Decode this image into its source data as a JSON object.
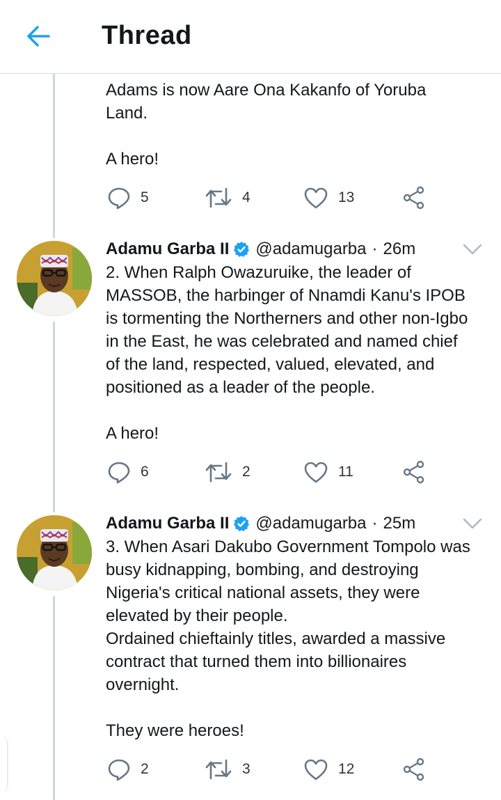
{
  "header": {
    "title": "Thread"
  },
  "colors": {
    "accent": "#1da1f2",
    "icon": "#657786",
    "thread_line": "#cfd6dc"
  },
  "top_tweet": {
    "text": "Adams is now Aare Ona Kakanfo of Yoruba\nLand.\n\nA hero!",
    "replies": "5",
    "retweets": "4",
    "likes": "13"
  },
  "tweets": [
    {
      "author": "Adamu Garba II",
      "handle": "@adamugarba",
      "separator": "·",
      "time": "26m",
      "text": "2. When Ralph Owazuruike, the leader of\nMASSOB, the harbinger of Nnamdi Kanu's IPOB\nis tormenting the Northerners and other non-Igbo\nin the East, he was celebrated and named chief\nof the land, respected, valued, elevated, and\npositioned as a leader of the people.\n\nA hero!",
      "replies": "6",
      "retweets": "2",
      "likes": "11"
    },
    {
      "author": "Adamu Garba II",
      "handle": "@adamugarba",
      "separator": "·",
      "time": "25m",
      "text": "3. When Asari Dakubo Government Tompolo was\nbusy kidnapping, bombing, and destroying\nNigeria's critical national assets, they were\nelevated by their people.\nOrdained chieftainly titles, awarded a massive\ncontract that turned them into billionaires\novernight.\n\nThey were heroes!",
      "replies": "2",
      "retweets": "3",
      "likes": "12"
    }
  ],
  "icons": {
    "back": "arrow-left-icon",
    "reply": "reply-bubble-icon",
    "retweet": "retweet-icon",
    "like": "heart-icon",
    "share": "share-icon",
    "verified": "verified-badge-icon",
    "menu": "chevron-down-icon"
  }
}
